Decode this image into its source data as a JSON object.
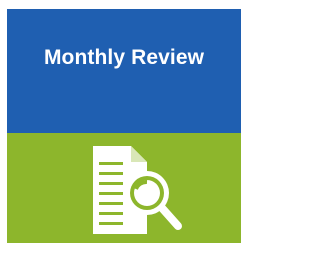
{
  "tile": {
    "title": "Monthly Review",
    "icon": "document-search-icon",
    "colors": {
      "header_background": "#1F5FB1",
      "icon_panel_background": "#8DB62C",
      "title_text": "#FFFFFF",
      "icon": "#FFFFFF"
    }
  }
}
